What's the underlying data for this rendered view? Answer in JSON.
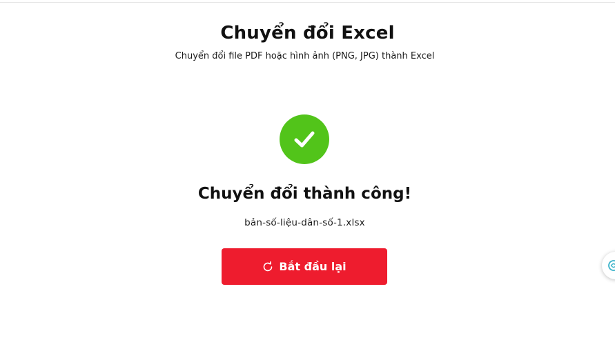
{
  "header": {
    "title": "Chuyển đổi Excel",
    "subtitle": "Chuyển đổi file PDF hoặc hình ảnh (PNG, JPG) thành Excel"
  },
  "result": {
    "status_icon": "checkmark-circle-icon",
    "message": "Chuyển đổi thành công!",
    "file_name": "bản-số-liệu-dân-số-1.xlsx"
  },
  "actions": {
    "restart_label": "Bắt đầu lại",
    "restart_icon": "refresh-icon"
  },
  "side_widget": {
    "icon": "assistant-widget-icon"
  },
  "colors": {
    "success": "#52c41a",
    "primary_button": "#ee1c2e",
    "widget_icon": "#38b2c9"
  }
}
